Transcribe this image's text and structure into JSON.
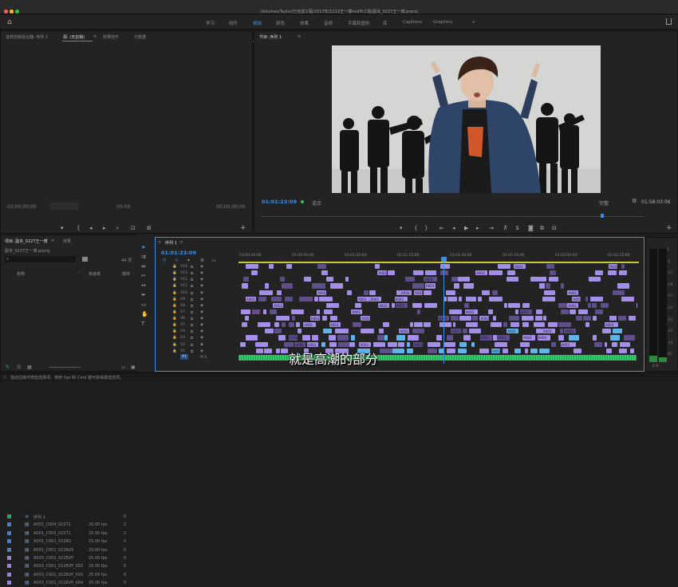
{
  "window": {
    "title": "/Volumes/Taylor/已完成工程/2017年/1213王一博muPR工程/副本_0227王一博.prproj"
  },
  "workspaces": [
    "学习",
    "组件",
    "编辑",
    "颜色",
    "效果",
    "音频",
    "字幕和图形",
    "库",
    "Captions",
    "Graphics"
  ],
  "active_workspace": "编辑",
  "more": "»",
  "source_panel": {
    "tabs": [
      "音频剪辑混合器: 序列 1",
      "源: (无剪辑)",
      "效果控件",
      "元数据"
    ],
    "tab_more": "≡",
    "tc_in": "00;00;00;00",
    "tc_out": "00;00;00;00",
    "center": "00:00",
    "plus": "+"
  },
  "program": {
    "title": "节目: 序列 1",
    "menu": "≡",
    "timecode": "01:01:23:09",
    "fit": "适合",
    "quality": "完整",
    "duration": "01:58:03:06",
    "plus": "+"
  },
  "project": {
    "tabs": [
      "项目: 副本_0227王一博",
      "效果"
    ],
    "menu": "≡",
    "path": "副本_0227王一博.prproj",
    "count": "44 项",
    "columns": [
      "名称",
      "帧速率",
      "媒体"
    ],
    "sort": "^",
    "items": [
      {
        "name": "序列 1",
        "fps": "",
        "media": "0",
        "color": "#2da44e"
      },
      {
        "name": "A001_C004_02271",
        "fps": "25.00 fps",
        "media": "2",
        "color": "#4a7ec0"
      },
      {
        "name": "A001_C005_02271",
        "fps": "25.00 fps",
        "media": "2",
        "color": "#4a7ec0"
      },
      {
        "name": "A001_C001_02280",
        "fps": "25.00 fps",
        "media": "0",
        "color": "#4a7ec0"
      },
      {
        "name": "A001_C001_0228U5",
        "fps": "25.00 fps",
        "media": "0",
        "color": "#4a7ec0"
      },
      {
        "name": "A003_C001_0228VP",
        "fps": "25.00 fps",
        "media": "0",
        "color": "#9b7fd9"
      },
      {
        "name": "A003_C001_0228VP_002",
        "fps": "25.00 fps",
        "media": "0",
        "color": "#9b7fd9"
      },
      {
        "name": "A003_C001_0228VP_003",
        "fps": "25.00 fps",
        "media": "0",
        "color": "#9b7fd9"
      },
      {
        "name": "A003_C001_0228VP_004",
        "fps": "25.00 fps",
        "media": "0",
        "color": "#9b7fd9"
      }
    ]
  },
  "timeline": {
    "tab": "序列 1",
    "menu": "≡",
    "close": "×",
    "timecode": "01:01:23:09",
    "ruler": [
      "01:00:30:00",
      "01:00:45:00",
      "01:01:00:00",
      "01:01:15:00",
      "01:01:30:00",
      "01:01:45:00",
      "01:02:00:00",
      "01:02:15:00"
    ],
    "tracks": [
      "V14",
      "V13",
      "V12",
      "V11",
      "V10",
      "V9",
      "V8",
      "V7",
      "V6",
      "V5",
      "V4",
      "V3",
      "V2",
      "V1"
    ],
    "audio_track": "A1",
    "clip_label": "A003",
    "subtitle": "就是高潮的部分"
  },
  "meters": {
    "values": [
      "0",
      "-6",
      "-12",
      "-18",
      "-24",
      "-30",
      "-36",
      "-42",
      "-48",
      "dB"
    ],
    "solo": "S S"
  },
  "status": {
    "text": "拖动边缘可修剪选择项。使用 Opt 和 Cmd 键可获得其他选项。"
  },
  "colors": {
    "accent": "#3c8fe0",
    "video_clip": "#a38ee8",
    "video_clip_dark": "#5e4f8a",
    "audio_clip": "#2fcf6b",
    "audio_clip_alt": "#5fb3e8",
    "playhead": "#3c8fe0"
  }
}
